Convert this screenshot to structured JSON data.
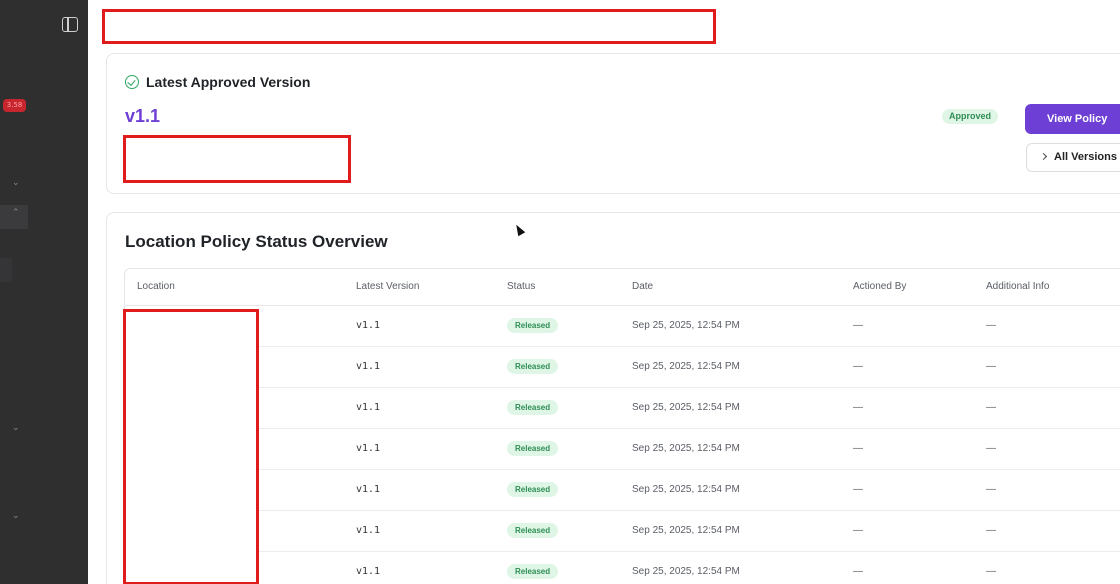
{
  "sidebar": {
    "badge": "3.58"
  },
  "approved": {
    "heading": "Latest Approved Version",
    "version": "v1.1",
    "status": "Approved",
    "view_label": "View Policy",
    "versions_label": "All Versions"
  },
  "overview": {
    "title": "Location Policy Status Overview",
    "columns": [
      "Location",
      "Latest Version",
      "Status",
      "Date",
      "Actioned By",
      "Additional Info"
    ],
    "rows": [
      {
        "location": "",
        "version": "v1.1",
        "status": "Released",
        "date": "Sep 25, 2025, 12:54 PM",
        "actioned_by": "—",
        "info": "—"
      },
      {
        "location": "",
        "version": "v1.1",
        "status": "Released",
        "date": "Sep 25, 2025, 12:54 PM",
        "actioned_by": "—",
        "info": "—"
      },
      {
        "location": "",
        "version": "v1.1",
        "status": "Released",
        "date": "Sep 25, 2025, 12:54 PM",
        "actioned_by": "—",
        "info": "—"
      },
      {
        "location": "",
        "version": "v1.1",
        "status": "Released",
        "date": "Sep 25, 2025, 12:54 PM",
        "actioned_by": "—",
        "info": "—"
      },
      {
        "location": "",
        "version": "v1.1",
        "status": "Released",
        "date": "Sep 25, 2025, 12:54 PM",
        "actioned_by": "—",
        "info": "—"
      },
      {
        "location": "",
        "version": "v1.1",
        "status": "Released",
        "date": "Sep 25, 2025, 12:54 PM",
        "actioned_by": "—",
        "info": "—"
      },
      {
        "location": "",
        "version": "v1.1",
        "status": "Released",
        "date": "Sep 25, 2025, 12:54 PM",
        "actioned_by": "—",
        "info": "—"
      }
    ]
  },
  "colors": {
    "accent": "#6d3fd4",
    "success": "#2fa862",
    "redaction": "#e01b1b"
  },
  "icons": [
    "panel-toggle-icon",
    "check-circle-icon",
    "chevron-right-icon",
    "chevron-down-icon"
  ]
}
